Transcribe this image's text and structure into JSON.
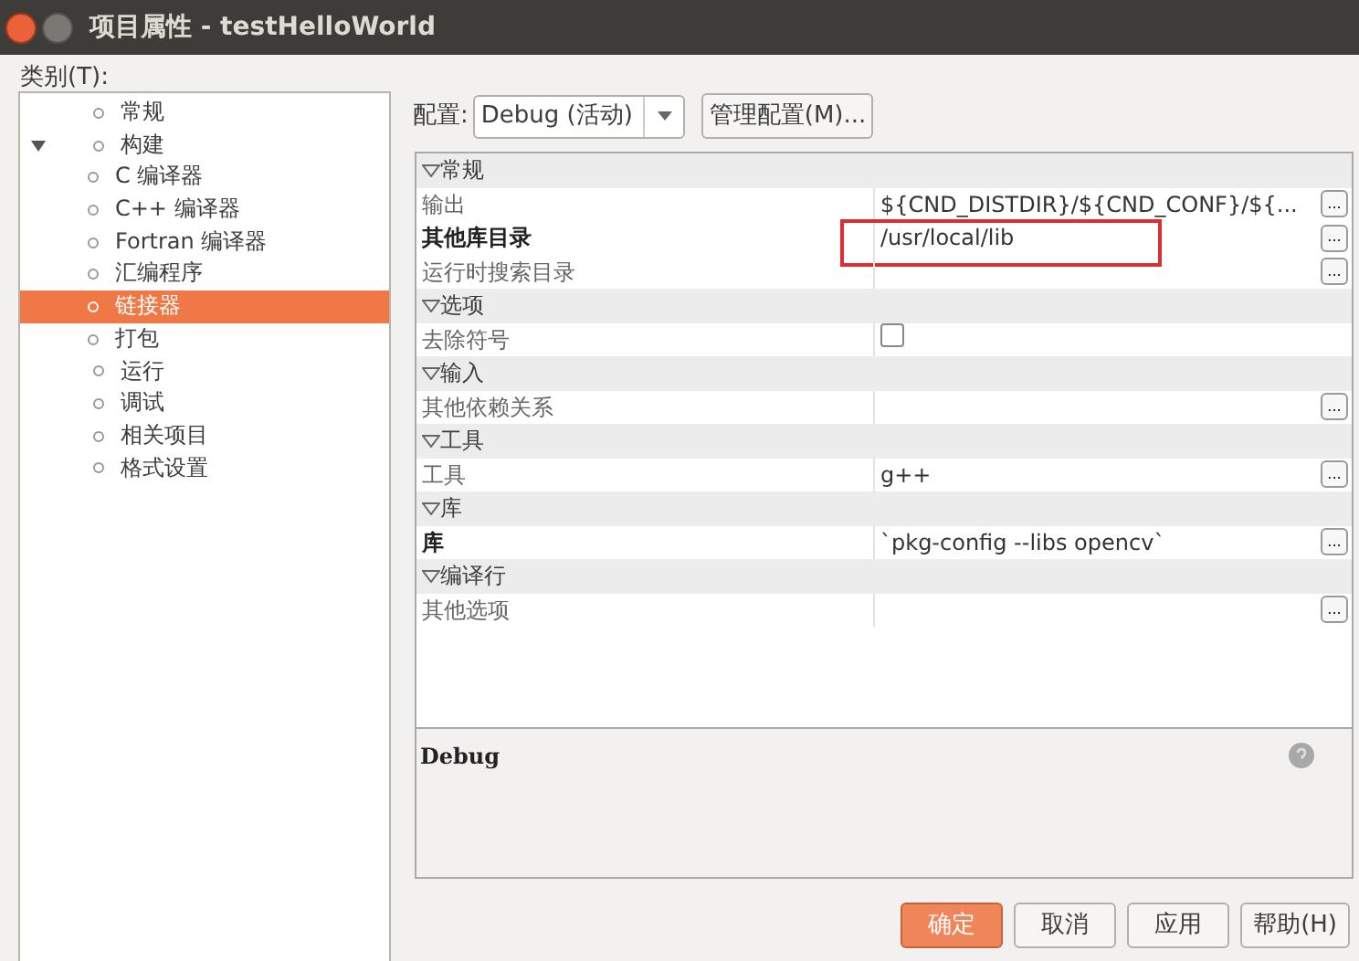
{
  "window": {
    "title": "项目属性 - testHelloWorld"
  },
  "categories": {
    "label": "类别(T):",
    "items": [
      {
        "label": "常规",
        "selected": false
      },
      {
        "label": "构建",
        "selected": false,
        "expanded": true,
        "children": [
          {
            "label": "C 编译器",
            "selected": false
          },
          {
            "label": "C++ 编译器",
            "selected": false
          },
          {
            "label": "Fortran 编译器",
            "selected": false
          },
          {
            "label": "汇编程序",
            "selected": false
          },
          {
            "label": "链接器",
            "selected": true
          },
          {
            "label": "打包",
            "selected": false
          }
        ]
      },
      {
        "label": "运行",
        "selected": false
      },
      {
        "label": "调试",
        "selected": false
      },
      {
        "label": "相关项目",
        "selected": false
      },
      {
        "label": "格式设置",
        "selected": false
      }
    ]
  },
  "configuration": {
    "label": "配置:",
    "value": "Debug (活动)",
    "manage_button": "管理配置(M)..."
  },
  "properties": [
    {
      "kind": "category",
      "label": "常规",
      "expanded": true
    },
    {
      "kind": "text",
      "label": "输出",
      "value": "${CND_DISTDIR}/${CND_CONF}/${...",
      "bold": false,
      "has_button": true,
      "highlighted": false
    },
    {
      "kind": "text",
      "label": "其他库目录",
      "value": "/usr/local/lib",
      "bold": true,
      "has_button": true,
      "highlighted": true
    },
    {
      "kind": "text",
      "label": "运行时搜索目录",
      "bold": false,
      "has_button": true,
      "highlighted": false
    },
    {
      "kind": "category",
      "label": "选项",
      "expanded": true
    },
    {
      "kind": "checkbox",
      "label": "去除符号",
      "checked": false,
      "bold": false,
      "has_button": false,
      "highlighted": false
    },
    {
      "kind": "category",
      "label": "输入",
      "expanded": true
    },
    {
      "kind": "text",
      "label": "其他依赖关系",
      "bold": false,
      "has_button": true,
      "highlighted": false
    },
    {
      "kind": "category",
      "label": "工具",
      "expanded": true
    },
    {
      "kind": "text",
      "label": "工具",
      "value": "g++",
      "bold": false,
      "has_button": true,
      "highlighted": false
    },
    {
      "kind": "category",
      "label": "库",
      "expanded": true
    },
    {
      "kind": "text",
      "label": "库",
      "value": "`pkg-config --libs opencv`",
      "bold": true,
      "has_button": true,
      "highlighted": false
    },
    {
      "kind": "category",
      "label": "编译行",
      "expanded": true
    },
    {
      "kind": "text",
      "label": "其他选项",
      "bold": false,
      "has_button": true,
      "highlighted": false
    }
  ],
  "ellipsis": "...",
  "description": {
    "title": "Debug"
  },
  "buttons": [
    {
      "label": "确定",
      "primary": true
    },
    {
      "label": "取消",
      "primary": false
    },
    {
      "label": "应用",
      "primary": false
    },
    {
      "label": "帮助(H)",
      "primary": false
    }
  ]
}
